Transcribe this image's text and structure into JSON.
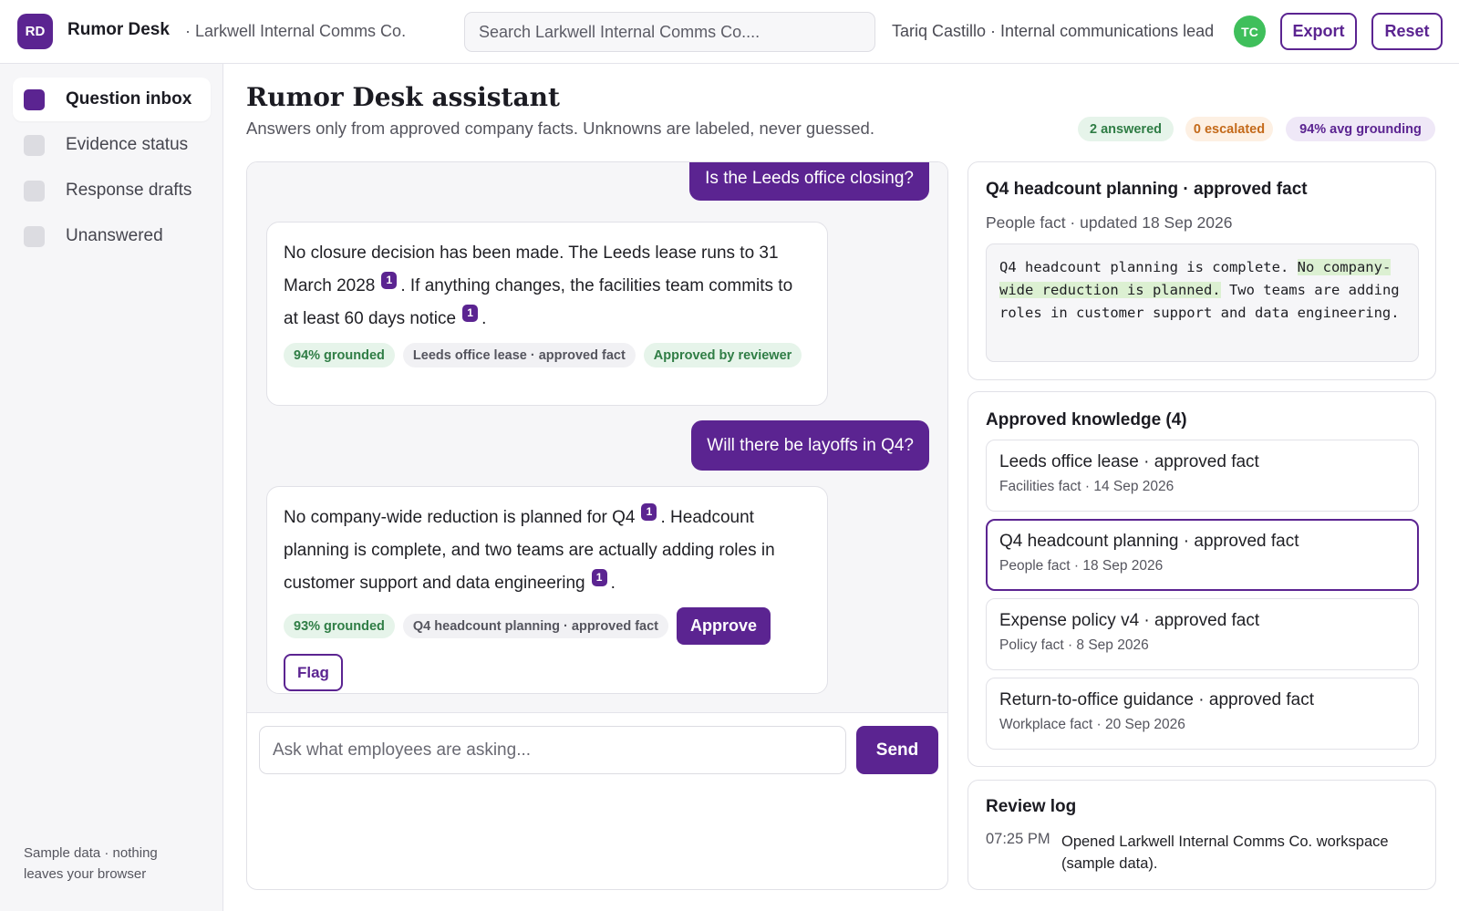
{
  "header": {
    "logo": "RD",
    "app_name": "Rumor Desk",
    "org": "· Larkwell Internal Comms Co.",
    "search_placeholder": "Search Larkwell Internal Comms Co....",
    "user": "Tariq Castillo · Internal communications lead",
    "avatar": "TC",
    "export_label": "Export",
    "reset_label": "Reset"
  },
  "sidebar": {
    "items": [
      {
        "label": "Question inbox",
        "active": true
      },
      {
        "label": "Evidence status",
        "active": false
      },
      {
        "label": "Response drafts",
        "active": false
      },
      {
        "label": "Unanswered",
        "active": false
      }
    ],
    "footer": "Sample data · nothing leaves your browser"
  },
  "main": {
    "title": "Rumor Desk assistant",
    "subtitle": "Answers only from approved company facts. Unknowns are labeled, never guessed.",
    "stats": {
      "answered": "2 answered",
      "escalated": "0 escalated",
      "grounding": "94% avg grounding"
    }
  },
  "chat": {
    "q1": "Is the Leeds office closing?",
    "a1": {
      "part1": "No closure decision has been made. The Leeds lease runs to 31 March 2028",
      "cite1": "1",
      "part2": ". If anything changes, the facilities team commits to at least 60 days notice",
      "cite2": "1",
      "part3": ".",
      "grounded": "94% grounded",
      "source": "Leeds office lease · approved fact",
      "status": "Approved by reviewer"
    },
    "q2": "Will there be layoffs in Q4?",
    "a2": {
      "part1": "No company-wide reduction is planned for Q4",
      "cite1": "1",
      "part2": ". Headcount planning is complete, and two teams are actually adding roles in customer support and data engineering",
      "cite2": "1",
      "part3": ".",
      "grounded": "93% grounded",
      "source": "Q4 headcount planning · approved fact",
      "approve_label": "Approve",
      "flag_label": "Flag"
    },
    "composer_placeholder": "Ask what employees are asking...",
    "send_label": "Send"
  },
  "fact_panel": {
    "title": "Q4 headcount planning · approved fact",
    "meta": "People fact · updated 18 Sep 2026",
    "body_pre": "Q4 headcount planning is complete. ",
    "body_highlight": "No company-wide reduction is planned.",
    "body_post": " Two teams are adding roles in customer support and data engineering."
  },
  "knowledge": {
    "title": "Approved knowledge (4)",
    "items": [
      {
        "name": "Leeds office lease · approved fact",
        "meta": "Facilities fact · 14 Sep 2026"
      },
      {
        "name": "Q4 headcount planning · approved fact",
        "meta": "People fact · 18 Sep 2026"
      },
      {
        "name": "Expense policy v4 · approved fact",
        "meta": "Policy fact · 8 Sep 2026"
      },
      {
        "name": "Return-to-office guidance · approved fact",
        "meta": "Workplace fact · 20 Sep 2026"
      }
    ]
  },
  "review_log": {
    "title": "Review log",
    "entries": [
      {
        "time": "07:25 PM",
        "text": "Opened Larkwell Internal Comms Co. workspace (sample data)."
      }
    ]
  },
  "colors": {
    "accent": "#5b2491",
    "success": "#2f7d45",
    "warning": "#c46a1a",
    "avatar": "#3fbf5b",
    "highlight": "#dcf0d2"
  }
}
